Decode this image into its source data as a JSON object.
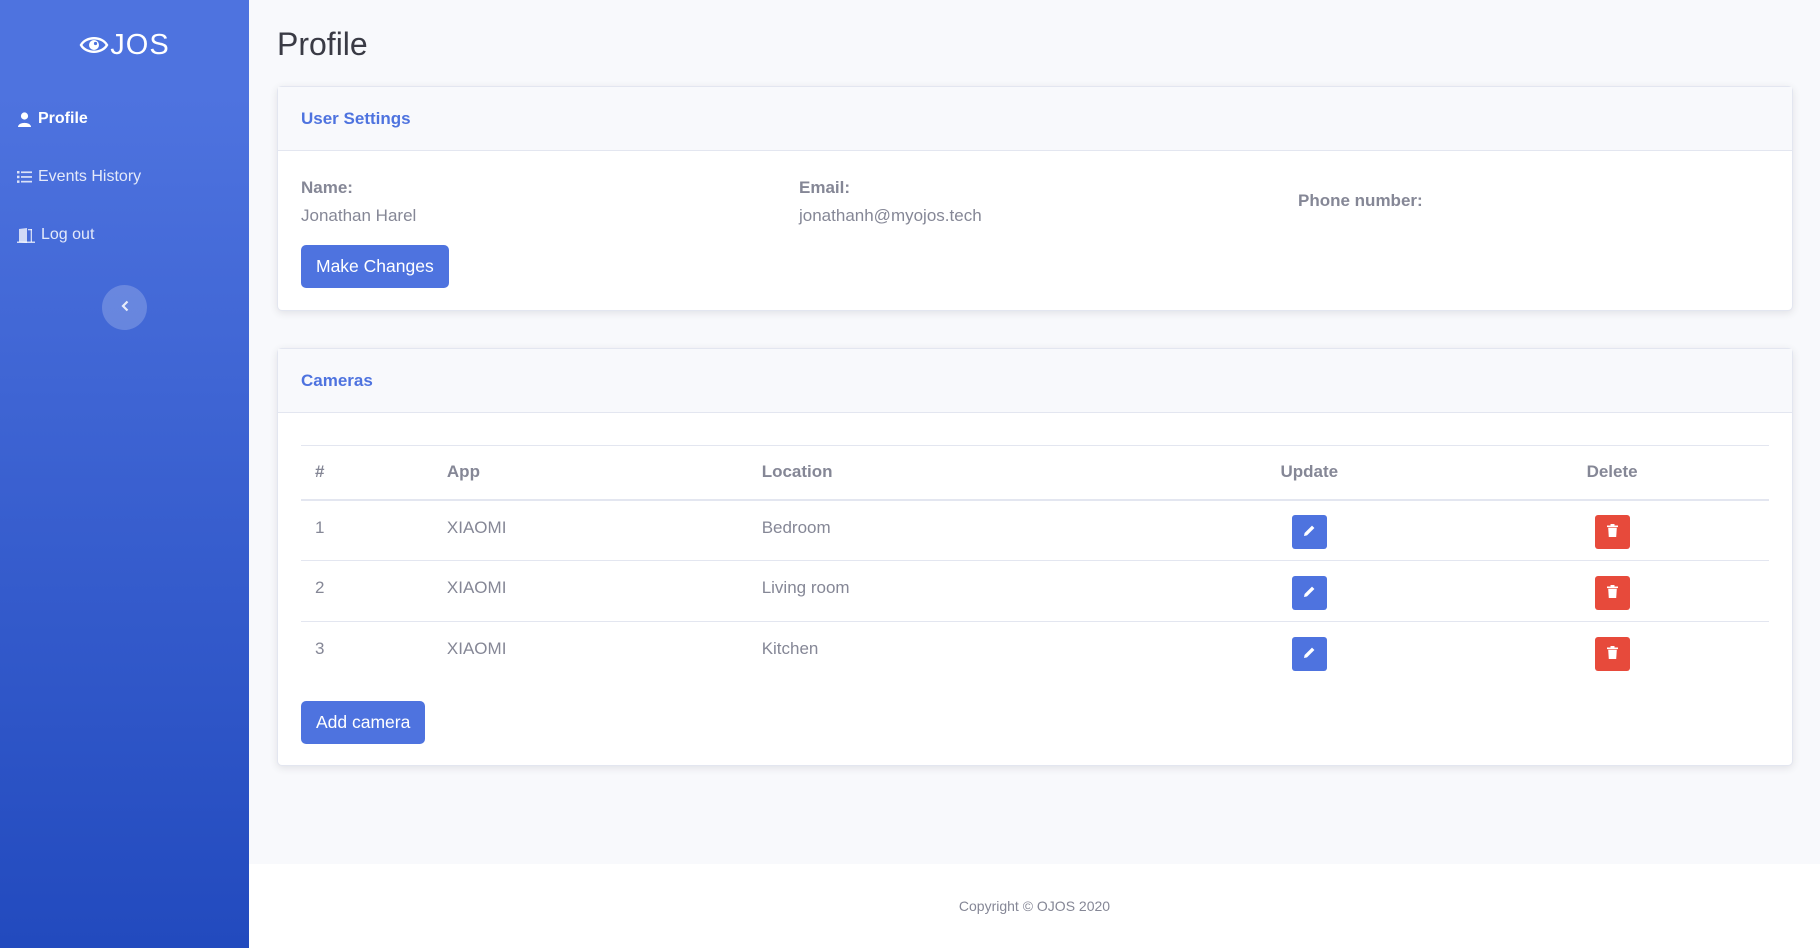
{
  "brand": {
    "logo_text": "JOS",
    "logo_icon": "eye-icon"
  },
  "sidebar": {
    "items": [
      {
        "label": "Profile",
        "icon": "user-icon",
        "active": true
      },
      {
        "label": "Events History",
        "icon": "list-icon",
        "active": false
      },
      {
        "label": "Log out",
        "icon": "door-icon",
        "active": false
      }
    ],
    "toggle_icon": "chevron-left-icon"
  },
  "page": {
    "title": "Profile"
  },
  "user_settings": {
    "header": "User Settings",
    "name_label": "Name:",
    "name_value": "Jonathan Harel",
    "email_label": "Email:",
    "email_value": "jonathanh@myojos.tech",
    "phone_label": "Phone number:",
    "phone_value": "",
    "make_changes_label": "Make Changes"
  },
  "cameras": {
    "header": "Cameras",
    "columns": [
      "#",
      "App",
      "Location",
      "Update",
      "Delete"
    ],
    "rows": [
      {
        "num": "1",
        "app": "XIAOMI",
        "location": "Bedroom"
      },
      {
        "num": "2",
        "app": "XIAOMI",
        "location": "Living room"
      },
      {
        "num": "3",
        "app": "XIAOMI",
        "location": "Kitchen"
      }
    ],
    "add_label": "Add camera",
    "update_icon": "pencil-icon",
    "delete_icon": "trash-icon"
  },
  "footer": {
    "copyright": "Copyright © OJOS 2020"
  },
  "colors": {
    "primary": "#4e73df",
    "danger": "#e74a3b",
    "sidebar_bottom": "#224abe"
  }
}
